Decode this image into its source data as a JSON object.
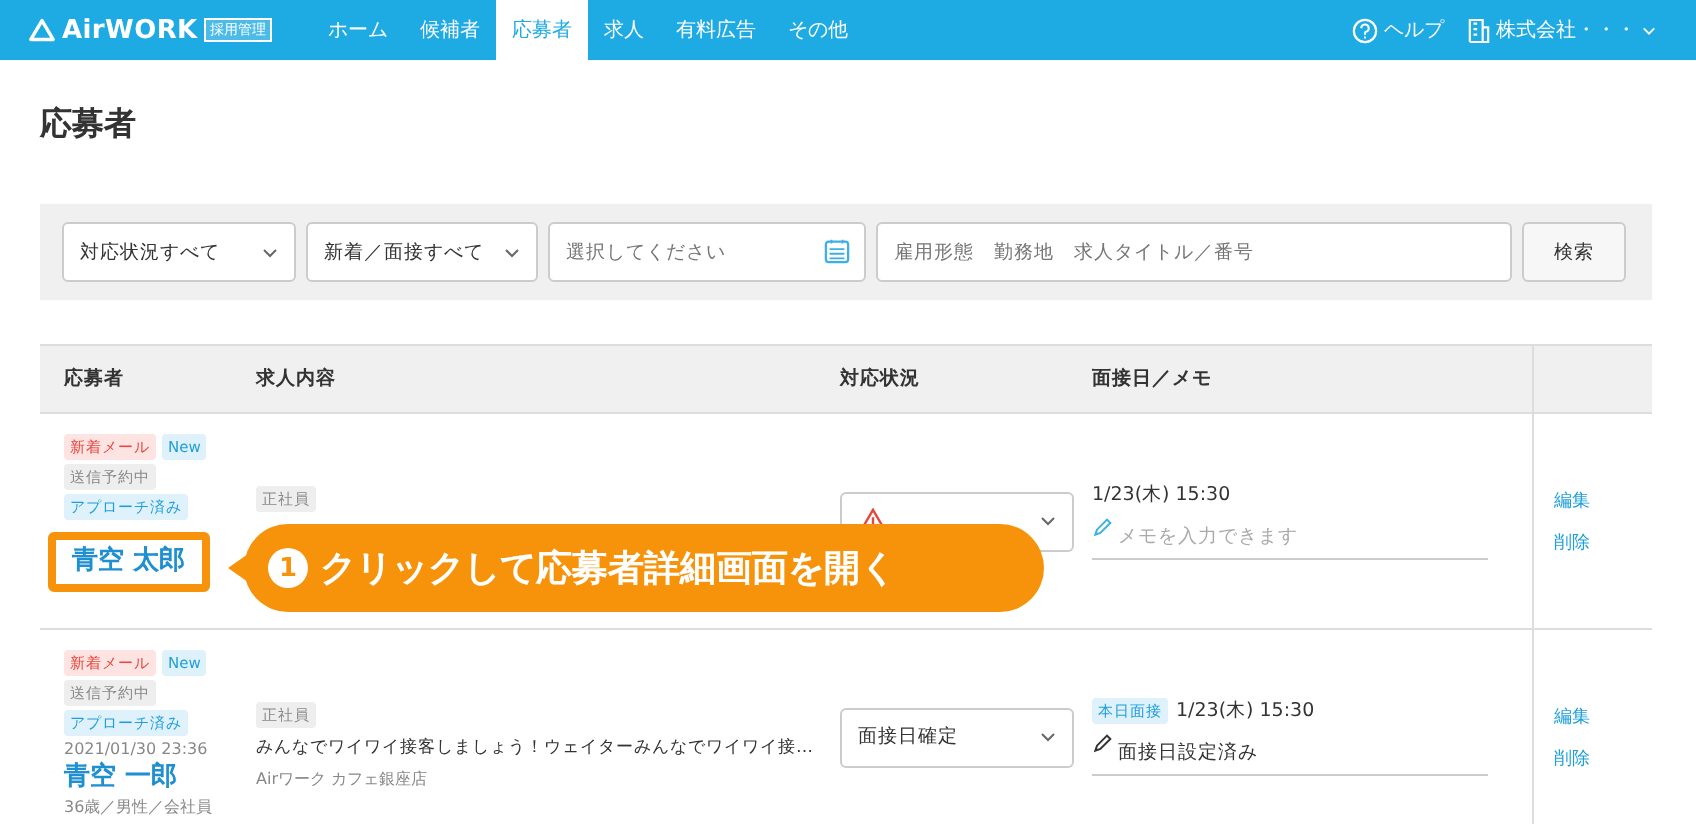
{
  "header": {
    "logo": "AirWORK",
    "logo_badge": "採用管理",
    "nav": [
      {
        "label": "ホーム",
        "selected": false
      },
      {
        "label": "候補者",
        "selected": false
      },
      {
        "label": "応募者",
        "selected": true
      },
      {
        "label": "求人",
        "selected": false
      },
      {
        "label": "有料広告",
        "selected": false
      },
      {
        "label": "その他",
        "selected": false
      }
    ],
    "help": "ヘルプ",
    "company": "株式会社・・・"
  },
  "page_title": "応募者",
  "filters": {
    "status": "対応状況すべて",
    "type": "新着／面接すべて",
    "date": {
      "placeholder": "選択してください"
    },
    "keyword": {
      "placeholder": "雇用形態　勤務地　求人タイトル／番号"
    },
    "search_button": "検索"
  },
  "table": {
    "columns": [
      "応募者",
      "求人内容",
      "対応状況",
      "面接日／メモ"
    ],
    "rows": [
      {
        "tags": [
          {
            "label": "新着メール",
            "kind": "mail"
          },
          {
            "label": "New",
            "kind": "new"
          },
          {
            "label": "送信予約中",
            "kind": "pending"
          },
          {
            "label": "アプローチ済み",
            "kind": "approach"
          }
        ],
        "name": "青空 太郎",
        "highlighted": true,
        "employment": "正社員",
        "status": {
          "kind": "warning"
        },
        "interview_date": "1/23(木) 15:30",
        "memo": {
          "placeholder": "メモを入力できます"
        },
        "actions": [
          "編集",
          "削除"
        ]
      },
      {
        "tags": [
          {
            "label": "新着メール",
            "kind": "mail"
          },
          {
            "label": "New",
            "kind": "new"
          },
          {
            "label": "送信予約中",
            "kind": "pending"
          },
          {
            "label": "アプローチ済み",
            "kind": "approach"
          }
        ],
        "date": "2021/01/30 23:36",
        "name": "青空 一郎",
        "highlighted": false,
        "profile": "36歳／男性／会社員",
        "employment": "正社員",
        "job_title": "みんなでワイワイ接客しましょう！ウェイターみんなでワイワイ接…",
        "store": "Airワーク カフェ銀座店",
        "status": {
          "kind": "plain",
          "label": "面接日確定"
        },
        "interview_badge": "本日面接",
        "interview_date": "1/23(木) 15:30",
        "memo": {
          "value": "面接日設定済み"
        },
        "actions": [
          "編集",
          "削除"
        ]
      }
    ]
  },
  "callout": {
    "number": "1",
    "text": "クリックして応募者詳細画面を開く"
  }
}
